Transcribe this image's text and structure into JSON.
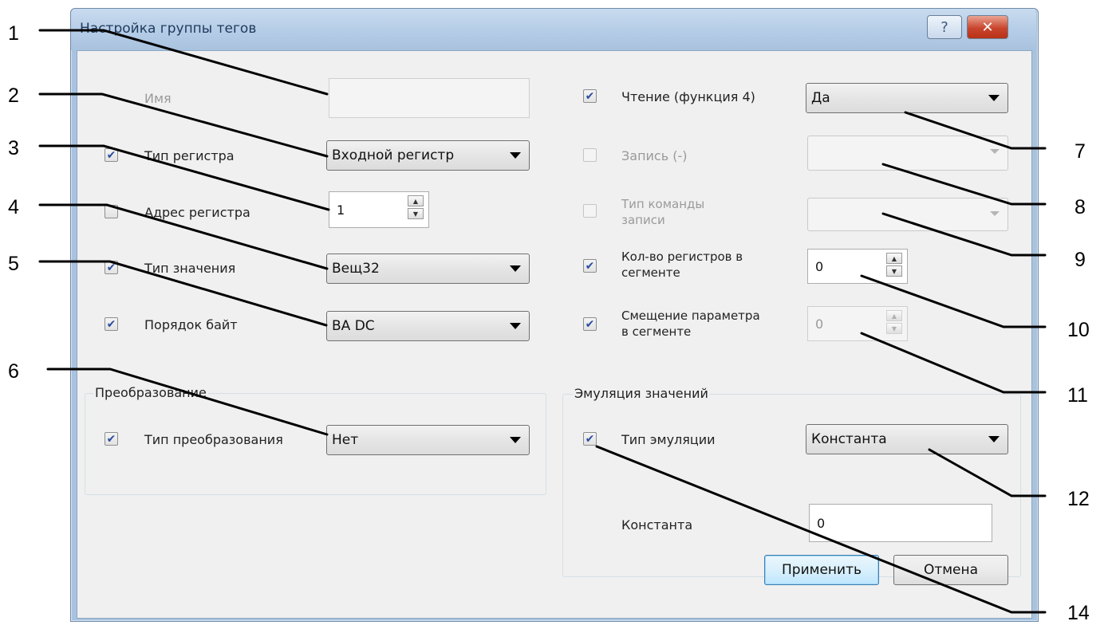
{
  "dialog": {
    "title": "Настройка группы тегов",
    "help_label": "?",
    "close_label": "✕"
  },
  "left": {
    "name_label": "Имя",
    "name_value": "",
    "register_type_label": "Тип регистра",
    "register_type_value": "Входной регистр",
    "register_address_label": "Адрес регистра",
    "register_address_value": "1",
    "value_type_label": "Тип значения",
    "value_type_value": "Вещ32",
    "byte_order_label": "Порядок байт",
    "byte_order_value": "BA DC"
  },
  "conversion": {
    "group_title": "Преобразование",
    "type_label": "Тип преобразования",
    "type_value": "Нет"
  },
  "right": {
    "read_label": "Чтение (функция 4)",
    "read_value": "Да",
    "write_label": "Запись (-)",
    "write_value": "",
    "write_cmd_label_1": "Тип команды",
    "write_cmd_label_2": "записи",
    "write_cmd_value": "",
    "count_label_1": "Кол-во регистров в",
    "count_label_2": "сегменте",
    "count_value": "0",
    "offset_label_1": "Смещение параметра",
    "offset_label_2": "в сегменте",
    "offset_value": "0"
  },
  "emulation": {
    "group_title": "Эмуляция значений",
    "type_label": "Тип эмуляции",
    "type_value": "Константа",
    "constant_label": "Константа",
    "constant_value": "0"
  },
  "buttons": {
    "apply": "Применить",
    "cancel": "Отмена"
  },
  "checkboxes": {
    "register_type": true,
    "register_address": false,
    "value_type": true,
    "byte_order": true,
    "conversion": true,
    "read": true,
    "write": false,
    "write_cmd": false,
    "count": true,
    "offset": true,
    "emulation": true
  },
  "callouts": {
    "n1": "1",
    "n2": "2",
    "n3": "3",
    "n4": "4",
    "n5": "5",
    "n6": "6",
    "n7": "7",
    "n8": "8",
    "n9": "9",
    "n10": "10",
    "n11": "11",
    "n12": "12",
    "n14": "14"
  }
}
